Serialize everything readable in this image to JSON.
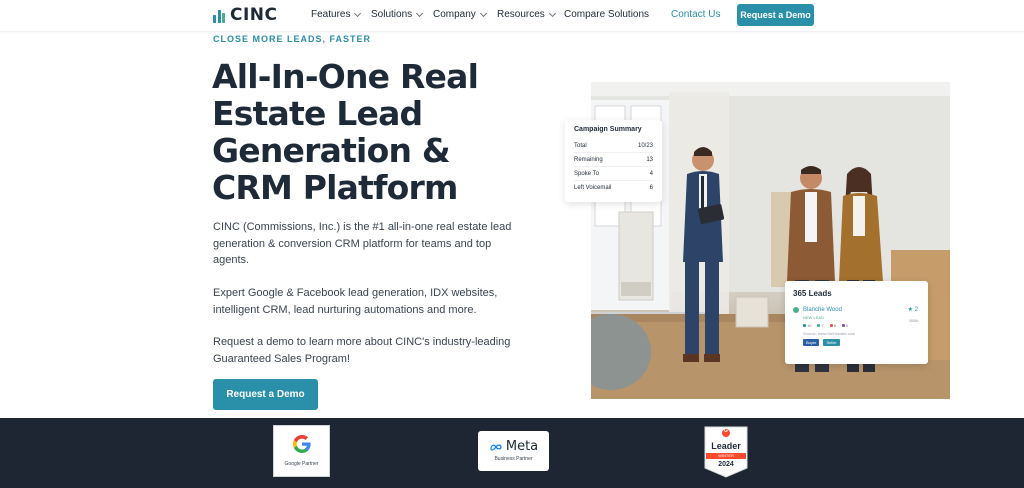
{
  "brand": {
    "logo_text": "CINC",
    "accent": "#2a8fa8",
    "accent_green": "#4ab08c",
    "dark": "#1e2a38",
    "strip_bg": "#1f2633"
  },
  "nav": {
    "items": [
      {
        "label": "Features"
      },
      {
        "label": "Solutions"
      },
      {
        "label": "Company"
      },
      {
        "label": "Resources"
      },
      {
        "label": "Compare Solutions"
      }
    ],
    "contact": "Contact Us",
    "cta": "Request a Demo"
  },
  "hero": {
    "eyebrow": "CLOSE MORE LEADS, FASTER",
    "headline": "All-In-One Real Estate Lead Generation & CRM Platform",
    "paragraphs": [
      "CINC (Commissions, Inc.) is the #1 all-in-one real estate lead generation & conversion CRM platform for teams and top agents.",
      "Expert Google & Facebook lead generation, IDX websites, intelligent CRM, lead nurturing automations and more.",
      "Request a demo to learn more about CINC's industry-leading Guaranteed Sales Program!"
    ],
    "cta": "Request a Demo"
  },
  "campaign_card": {
    "title": "Campaign Summary",
    "rows": [
      {
        "label": "Total",
        "value": "10/23"
      },
      {
        "label": "Remaining",
        "value": "13"
      },
      {
        "label": "Spoke To",
        "value": "4"
      },
      {
        "label": "Left Voicemail",
        "value": "6"
      }
    ]
  },
  "leads_card": {
    "title": "365 Leads",
    "lead_name": "Blanche Wood",
    "lead_tag": "NEW LEAD",
    "star_count": "2",
    "lead_time": "555k",
    "icon_counts": [
      "10",
      "7",
      "6",
      "0"
    ],
    "email": "Source: www.theHubsite.com",
    "tags": [
      {
        "label": "Buyer",
        "color": "#2a5fa8"
      },
      {
        "label": "Seller",
        "color": "#2a8fa8"
      }
    ]
  },
  "badges": {
    "google_sub": "Google Partner",
    "meta_name": "Meta",
    "meta_sub": "Business Partner",
    "g2_top": "G",
    "g2_leader": "Leader",
    "g2_season": "WINTER",
    "g2_year": "2024"
  }
}
